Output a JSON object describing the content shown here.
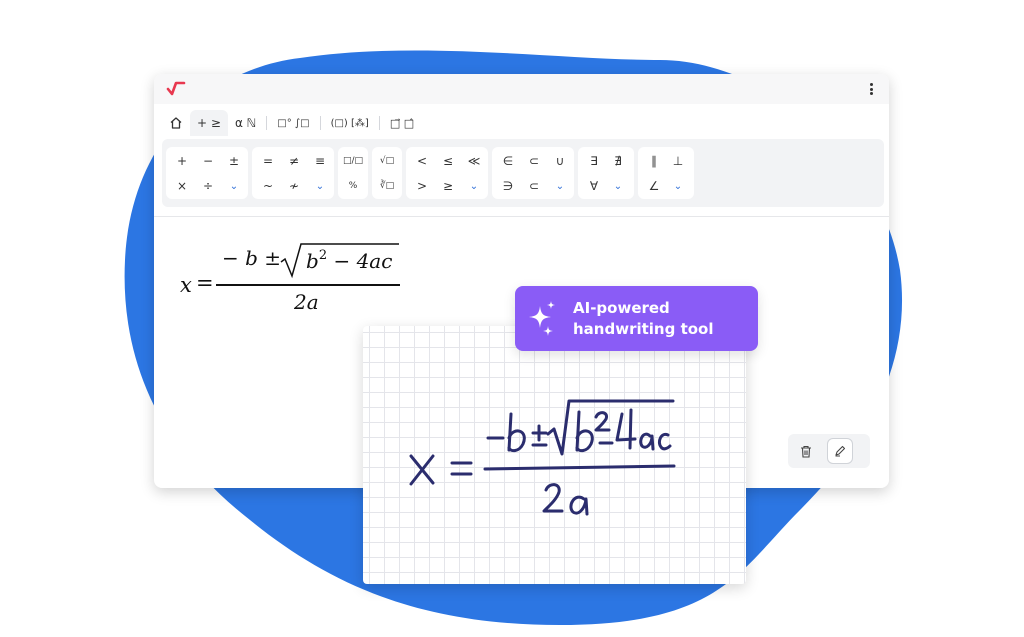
{
  "colors": {
    "blob": "#2c76e3",
    "badge": "#8a5cf6",
    "logo": "#e8384f",
    "ink": "#2b2d6e",
    "chevron": "#2f6fd8"
  },
  "window": {
    "logo_icon": "square-root-logo-icon",
    "menu_icon": "kebab-menu-icon"
  },
  "tabs": [
    {
      "icon": "home-icon"
    },
    {
      "label": "+ ≥"
    },
    {
      "label": "α ℕ"
    },
    {
      "label": "□° ∫□"
    },
    {
      "label": "(□) [⁂]"
    },
    {
      "label": "□⃗ □̂"
    }
  ],
  "palette": {
    "groups": [
      {
        "top": [
          "+",
          "−",
          "±"
        ],
        "bottom": [
          "×",
          "÷",
          "⌄"
        ]
      },
      {
        "top": [
          "=",
          "≠",
          "≡"
        ],
        "bottom": [
          "~",
          "≁",
          "⌄"
        ]
      },
      {
        "top": [
          "□/□"
        ],
        "bottom": [
          "%"
        ]
      },
      {
        "top": [
          "√□"
        ],
        "bottom": [
          "∛□"
        ]
      },
      {
        "top": [
          "<",
          "≤",
          "≪"
        ],
        "bottom": [
          ">",
          "≥",
          "⌄"
        ]
      },
      {
        "top": [
          "∈",
          "⊂",
          "∪"
        ],
        "bottom": [
          "∋",
          "⊂",
          "⌄"
        ]
      },
      {
        "top": [
          "∃",
          "∄"
        ],
        "bottom": [
          "∀",
          "⌄"
        ]
      },
      {
        "top": [
          "∥",
          "⊥"
        ],
        "bottom": [
          "∠",
          "⌄"
        ]
      }
    ]
  },
  "formula": {
    "lhs": "x",
    "eq": "=",
    "num_minus_b": "− b ±",
    "radicand_b": "b",
    "radicand_exp": "2",
    "radicand_rest": "− 4ac",
    "denominator": "2a"
  },
  "tools": {
    "delete_icon": "trash-icon",
    "pen_icon": "pen-edit-icon"
  },
  "badge": {
    "icon": "sparkle-icon",
    "line1": "AI-powered",
    "line2": "handwriting tool"
  }
}
